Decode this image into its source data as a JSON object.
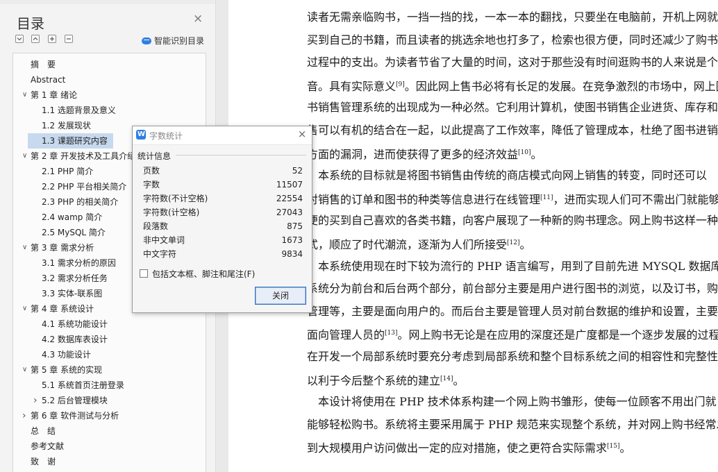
{
  "sidebar": {
    "title": "目录",
    "ai_button_label": "智能识别目录",
    "toc": [
      {
        "label": "摘　要",
        "level": 0,
        "expand": ""
      },
      {
        "label": "Abstract",
        "level": 0,
        "expand": ""
      },
      {
        "label": "第 1 章  绪论",
        "level": 0,
        "expand": "open"
      },
      {
        "label": "1.1  选题背景及意义",
        "level": 1,
        "expand": ""
      },
      {
        "label": "1.2  发展现状",
        "level": 1,
        "expand": ""
      },
      {
        "label": "1.3  课题研究内容",
        "level": 1,
        "expand": "",
        "selected": true
      },
      {
        "label": "第 2 章  开发技术及工具介绍",
        "level": 0,
        "expand": "open"
      },
      {
        "label": "2.1 PHP 简介",
        "level": 1,
        "expand": ""
      },
      {
        "label": "2.2 PHP  平台相关简介",
        "level": 1,
        "expand": ""
      },
      {
        "label": "2.3 PHP 的相关简介",
        "level": 1,
        "expand": ""
      },
      {
        "label": "2.4 wamp 简介",
        "level": 1,
        "expand": ""
      },
      {
        "label": "2.5 MySQL 简介",
        "level": 1,
        "expand": ""
      },
      {
        "label": "第 3 章  需求分析",
        "level": 0,
        "expand": "open"
      },
      {
        "label": "3.1 需求分析的原因",
        "level": 1,
        "expand": ""
      },
      {
        "label": "3.2 需求分析任务",
        "level": 1,
        "expand": ""
      },
      {
        "label": "3.3 实体-联系图",
        "level": 1,
        "expand": ""
      },
      {
        "label": "第 4 章  系统设计",
        "level": 0,
        "expand": "open"
      },
      {
        "label": "4.1 系统功能设计",
        "level": 1,
        "expand": ""
      },
      {
        "label": "4.2 数据库表设计",
        "level": 1,
        "expand": ""
      },
      {
        "label": "4.3  功能设计",
        "level": 1,
        "expand": ""
      },
      {
        "label": "第 5 章  系统的实现",
        "level": 0,
        "expand": "open"
      },
      {
        "label": "5.1  系统首页注册登录",
        "level": 1,
        "expand": ""
      },
      {
        "label": "5.2 后台管理模块",
        "level": 1,
        "expand": "closed"
      },
      {
        "label": "第 6 章  软件测试与分析",
        "level": 0,
        "expand": "closed"
      },
      {
        "label": "总　结",
        "level": 0,
        "expand": ""
      },
      {
        "label": "参考文献",
        "level": 0,
        "expand": ""
      },
      {
        "label": "致　谢",
        "level": 0,
        "expand": ""
      }
    ]
  },
  "document": {
    "lines": [
      {
        "text": "读者无需亲临购书，一挡一挡的找，一本一本的翻找，只要坐在电脑前，开机上网就能",
        "ref": ""
      },
      {
        "text": "买到自己的书籍，而且读者的挑选余地也打多了，检索也很方便，同时还减少了购书的",
        "ref": ""
      },
      {
        "text": "过程中的支出。为读者节省了大量的时间，这对于那些没有时间逛购书的人来说是个福",
        "ref": ""
      },
      {
        "text": "音。具有实际意义",
        "ref": "[9]",
        "tail": "。因此网上售书必将有长足的发展。在竞争激烈的市场中，网上图"
      },
      {
        "text": "书销售管理系统的出现成为一种必然。它利用计算机，使图书销售企业进货、库存和销",
        "ref": ""
      },
      {
        "text": "售可以有机的结合在一起，以此提高了工作效率，降低了管理成本，杜绝了图书进销方",
        "ref": ""
      },
      {
        "text": "方面的漏洞，进而使获得了更多的经济效益",
        "ref": "[10]",
        "tail": "。"
      },
      {
        "text": "　本系统的目标就是将图书销售由传统的商店模式向网上销售的转变，同时还可以",
        "ref": ""
      },
      {
        "text": "对销售的订单和图书的种类等信息进行在线管理",
        "ref": "[11]",
        "tail": "，进而实现人们可不需出门就能够方"
      },
      {
        "text": "便的买到自己喜欢的各类书籍，向客户展现了一种新的购书理念。网上购书这样一种方",
        "ref": ""
      },
      {
        "text": "式，顺应了时代潮流，逐渐为人们所接受",
        "ref": "[12]",
        "tail": "。"
      },
      {
        "text": "　本系统使用现在时下较为流行的 PHP 语言编写，用到了目前先进 MYSQL 数据库。",
        "ref": ""
      },
      {
        "text": "系统分为前台和后台两个部分，前台部分主要是用户进行图书的浏览，以及订书，购书",
        "ref": ""
      },
      {
        "text": "管理等，主要是面向用户的。而后台主要是管理人员对前台数据的维护和设置，主要是",
        "ref": ""
      },
      {
        "text": "面向管理人员的",
        "ref": "[13]",
        "tail": "。网上购书无论是在应用的深度还是广度都是一个逐步发展的过程，"
      },
      {
        "text": "在开发一个局部系统时要充分考虑到局部系统和整个目标系统之间的相容性和完整性，",
        "ref": ""
      },
      {
        "text": "以利于今后整个系统的建立",
        "ref": "[14]",
        "tail": "。"
      },
      {
        "text": "　本设计将使用在 PHP 技术体系构建一个网上购书雏形，使每一位顾客不用出门就",
        "ref": ""
      },
      {
        "text": "能够轻松购书。系统将主要采用属于 PHP 规范来实现整个系统，并对网上购书经常发",
        "ref": ""
      },
      {
        "text": "到大规模用户访问做出一定的应对措施，使之更符合实际需求",
        "ref": "[15]",
        "tail": "。"
      }
    ]
  },
  "dialog": {
    "title": "字数统计",
    "section": "统计信息",
    "stats": [
      {
        "label": "页数",
        "value": "52"
      },
      {
        "label": "字数",
        "value": "11507"
      },
      {
        "label": "字符数(不计空格)",
        "value": "22554"
      },
      {
        "label": "字符数(计空格)",
        "value": "27043"
      },
      {
        "label": "段落数",
        "value": "875"
      },
      {
        "label": "非中文单词",
        "value": "1673"
      },
      {
        "label": "中文字符",
        "value": "9834"
      }
    ],
    "checkbox_label": "包括文本框、脚注和尾注(F)",
    "close_button": "关闭"
  }
}
